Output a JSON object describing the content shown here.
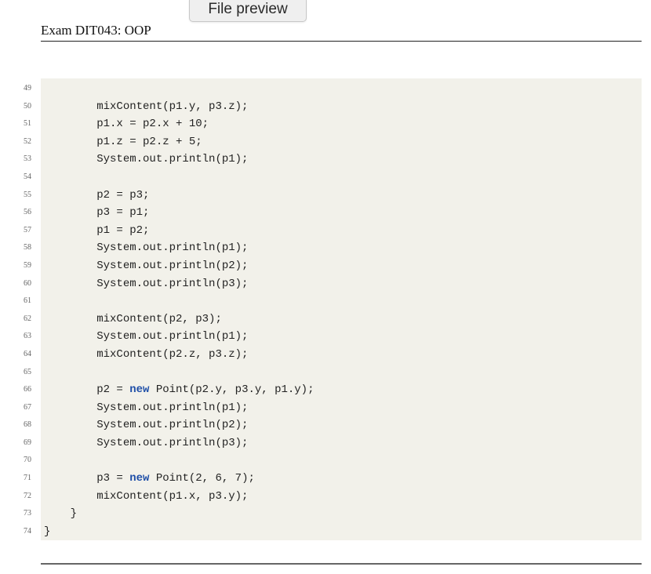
{
  "preview": {
    "label": "File preview"
  },
  "header": {
    "title": "Exam DIT043: OOP"
  },
  "code": {
    "lines": [
      {
        "num": "49",
        "indent": "",
        "text": ""
      },
      {
        "num": "50",
        "indent": "        ",
        "text": "mixContent(p1.y, p3.z);"
      },
      {
        "num": "51",
        "indent": "        ",
        "text": "p1.x = p2.x + 10;"
      },
      {
        "num": "52",
        "indent": "        ",
        "text": "p1.z = p2.z + 5;"
      },
      {
        "num": "53",
        "indent": "        ",
        "text": "System.out.println(p1);"
      },
      {
        "num": "54",
        "indent": "",
        "text": ""
      },
      {
        "num": "55",
        "indent": "        ",
        "text": "p2 = p3;"
      },
      {
        "num": "56",
        "indent": "        ",
        "text": "p3 = p1;"
      },
      {
        "num": "57",
        "indent": "        ",
        "text": "p1 = p2;"
      },
      {
        "num": "58",
        "indent": "        ",
        "text": "System.out.println(p1);"
      },
      {
        "num": "59",
        "indent": "        ",
        "text": "System.out.println(p2);"
      },
      {
        "num": "60",
        "indent": "        ",
        "text": "System.out.println(p3);"
      },
      {
        "num": "61",
        "indent": "",
        "text": ""
      },
      {
        "num": "62",
        "indent": "        ",
        "text": "mixContent(p2, p3);"
      },
      {
        "num": "63",
        "indent": "        ",
        "text": "System.out.println(p1);"
      },
      {
        "num": "64",
        "indent": "        ",
        "text": "mixContent(p2.z, p3.z);"
      },
      {
        "num": "65",
        "indent": "",
        "text": ""
      },
      {
        "num": "66",
        "indent": "        ",
        "pre": "p2 = ",
        "kw": "new",
        "post": " Point(p2.y, p3.y, p1.y);"
      },
      {
        "num": "67",
        "indent": "        ",
        "text": "System.out.println(p1);"
      },
      {
        "num": "68",
        "indent": "        ",
        "text": "System.out.println(p2);"
      },
      {
        "num": "69",
        "indent": "        ",
        "text": "System.out.println(p3);"
      },
      {
        "num": "70",
        "indent": "",
        "text": ""
      },
      {
        "num": "71",
        "indent": "        ",
        "pre": "p3 = ",
        "kw": "new",
        "post": " Point(2, 6, 7);"
      },
      {
        "num": "72",
        "indent": "        ",
        "text": "mixContent(p1.x, p3.y);"
      },
      {
        "num": "73",
        "indent": "    ",
        "text": "}"
      },
      {
        "num": "74",
        "indent": "",
        "text": "}"
      }
    ]
  }
}
